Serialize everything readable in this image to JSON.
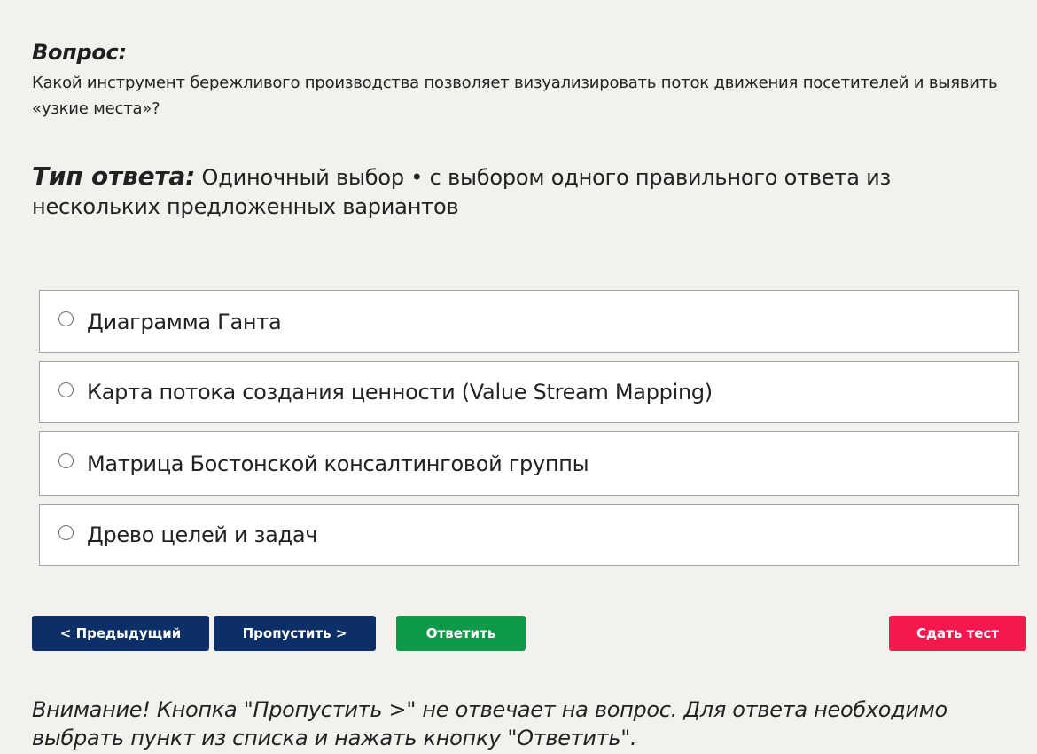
{
  "question": {
    "heading": "Вопрос:",
    "text": "Какой инструмент бережливого производства позволяет визуализировать поток движения посетителей и выявить «узкие места»?"
  },
  "answer_type": {
    "label": "Тип ответа:",
    "value": "Одиночный выбор • с выбором одного правильного ответа из нескольких предложенных вариантов"
  },
  "options": [
    {
      "label": "Диаграмма Ганта",
      "selected": false
    },
    {
      "label": "Карта потока создания ценности (Value Stream Mapping)",
      "selected": false
    },
    {
      "label": "Матрица Бостонской консалтинговой группы",
      "selected": false
    },
    {
      "label": "Древо целей и задач",
      "selected": false
    }
  ],
  "buttons": {
    "prev": "< Предыдущий",
    "skip": "Пропустить >",
    "answer": "Ответить",
    "submit": "Сдать тест"
  },
  "warning": "Внимание! Кнопка \"Пропустить >\" не отвечает на вопрос. Для ответа необходимо выбрать пункт из списка и нажать кнопку \"Ответить\".",
  "colors": {
    "background": "#f2f1ee",
    "nav_button": "#0b2f66",
    "answer_button": "#0f9a4a",
    "submit_button": "#f5184f"
  }
}
